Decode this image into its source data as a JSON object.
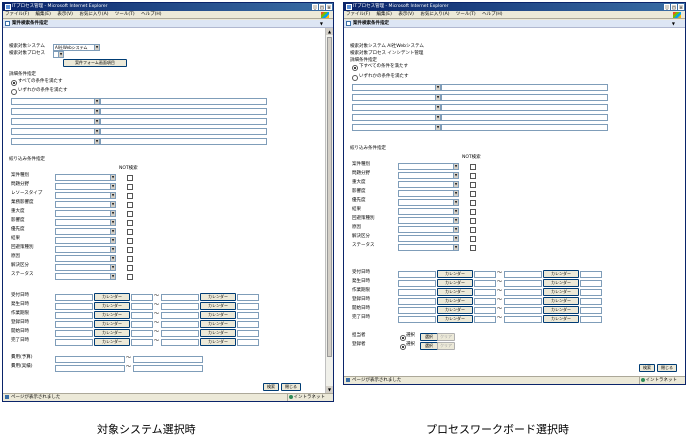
{
  "left": {
    "title": "ITプロセス管理 - Microsoft Internet Explorer",
    "menu": [
      "ファイル(F)",
      "編集(E)",
      "表示(V)",
      "お気に入り(A)",
      "ツール(T)",
      "ヘルプ(H)"
    ],
    "header": "案件検索条件指定",
    "system_label": "検索対象システム",
    "system_value": "AI社Webシステム",
    "process_label": "検索対象プロセス",
    "form_button": "案件フォーム画面項目",
    "search_cond": "詳細条件指定",
    "radio_all": "すべての条件を満たす",
    "radio_any": "いずれかの条件を満たす",
    "filter_title": "絞り込み条件指定",
    "not_label": "NOT検索",
    "fields": [
      "案件種別",
      "問題分野",
      "レソースタイプ",
      "業務影響度",
      "重大度",
      "影響度",
      "優先度",
      "結果",
      "回避策種別",
      "原因",
      "解決区分",
      "ステータス"
    ],
    "dates": [
      "受付日時",
      "発生日時",
      "作業期限",
      "登録日時",
      "開始日時",
      "完了日時"
    ],
    "cost": [
      "費用(予算)",
      "費用(実績)"
    ],
    "calendar": "カレンダー",
    "tilde": "～",
    "search_btn": "検索",
    "close_btn": "閉じる",
    "status": "ページが表示されました",
    "zone": "イントラネット"
  },
  "right": {
    "title": "ITプロセス管理 - Microsoft Internet Explorer",
    "menu": [
      "ファイル(F)",
      "編集(E)",
      "表示(V)",
      "お気に入り(A)",
      "ツール(T)",
      "ヘルプ(H)"
    ],
    "header": "案件検索条件指定",
    "system_line": "検索対象システム  AI社Webシステム",
    "process_line": "検索対象プロセス  インシデント管理",
    "search_cond": "詳細条件指定",
    "radio_all": "下すべての条件を満たす",
    "radio_any": "いずれかの条件を満たす",
    "filter_title": "絞り込み条件指定",
    "not_label": "NOT検索",
    "fields": [
      "案件種別",
      "問題分野",
      "重大度",
      "影響度",
      "優先度",
      "結果",
      "回避策種別",
      "原因",
      "解決区分",
      "ステータス"
    ],
    "dates": [
      "受付日時",
      "発生日時",
      "作業期限",
      "登録日時",
      "開始日時",
      "完了日時"
    ],
    "persons": [
      "担当者",
      "登録者"
    ],
    "person_choice": "選択",
    "select_btn": "選択",
    "clear_btn": "クリア",
    "calendar": "カレンダー",
    "tilde": "～",
    "search_btn": "検索",
    "close_btn": "閉じる",
    "status": "ページが表示されました",
    "zone": "イントラネット"
  },
  "captions": {
    "left": "対象システム選択時",
    "right": "プロセスワークボード選択時"
  },
  "colors": {
    "titlebar": "#0a246a",
    "chrome": "#ece9d8",
    "border": "#7f9db9"
  },
  "icons": [
    "ie-icon",
    "windows-flag-icon",
    "dropdown-arrow-icon",
    "page-icon",
    "intranet-icon"
  ]
}
